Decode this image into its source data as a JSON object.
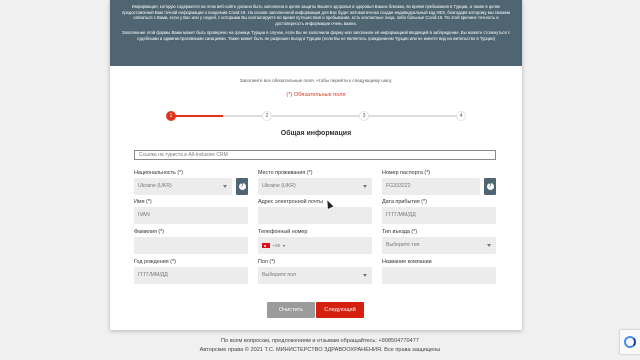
{
  "banner": {
    "para1": "Информация, которую содержится на этом веб-сайте должна быть заполнена в целях защиты Вашего здоровья и здоровья Ваших близких, во время пребывания в Турции, а также в целях предоставления Вам точной информации о пандемии Covid-19. На основе заполненной информации для Вас будет автоматически создан индивидуальный код HES, благодаря которому мы сможем связаться с Вами, если у Вас или у людей, с которыми Вы контактируете во время путешествия и пребывания, есть контактные лица, либо больные Covid-19. По этой причине точность и достоверность информации очень важна.",
    "para2": "Заполнение этой формы Вами может быть проверено на границе Турции в случае, если Вы не заполнили форму или заполнили её информацией вводящей в заблуждение, Вы можете столкнуться с судебными и административными санкциями. Также может быть не разрешен въезд в Турцию (если Вы не являетесь гражданином Турции или не имеете вид на жительство в Турции)"
  },
  "fill_note": "Заполните все обязательные поля, чтобы перейти к следующему шагу.",
  "required_note": "(*) Обязательные поля",
  "colors": {
    "accent": "#e2341d",
    "banner": "#4f6672",
    "next_button": "#d5200f",
    "clear_button": "#9b9b9b"
  },
  "stepper": {
    "steps": [
      "1",
      "2",
      "3",
      "4"
    ],
    "active_step": 1,
    "progress_fraction": 0.18
  },
  "section_title": "Общая информация",
  "tour_link_placeholder": "Ссылка на туриста в All-Inclusive CRM",
  "fields": {
    "nationality": {
      "label": "Национальность (*)",
      "value": "Ukraine (UKR)"
    },
    "residence": {
      "label": "Место проживания (*)",
      "value": "Ukraine (UKR)"
    },
    "passport": {
      "label": "Номер паспорта (*)",
      "value": "FG333222"
    },
    "first_name": {
      "label": "Имя (*)",
      "value": "IVAN"
    },
    "email": {
      "label": "Адрес электронной почты",
      "value": ""
    },
    "arrival_date": {
      "label": "Дата прибытия (*)",
      "placeholder": "ГГГГ/ММ/ДД"
    },
    "last_name": {
      "label": "Фамилия (*)",
      "value": ""
    },
    "phone": {
      "label": "Телефонный номер",
      "dial_code": "+90"
    },
    "entry_type": {
      "label": "Тип въезда (*)",
      "placeholder": "Выберите тип"
    },
    "birth_date": {
      "label": "Год рождения (*)",
      "placeholder": "ГГГГ/ММ/ДД"
    },
    "gender": {
      "label": "Пол (*)",
      "placeholder": "Выберите пол"
    },
    "company": {
      "label": "Название компании",
      "value": ""
    }
  },
  "buttons": {
    "clear": "Очистить",
    "next": "Следующий"
  },
  "footer": {
    "contact": "По всем вопросам, предложениям и отзывам обращайтесь: +908504770477",
    "copyright": "Авторские права © 2021 Т.С. МИНИСТЕРСТВО ЗДРАВООХРАНЕНИЯ. Все права защищены"
  },
  "icons": {
    "help": "question-circle-icon",
    "dropdown": "caret-down-icon",
    "flag": "turkey-flag-icon",
    "recaptcha": "recaptcha-icon"
  }
}
